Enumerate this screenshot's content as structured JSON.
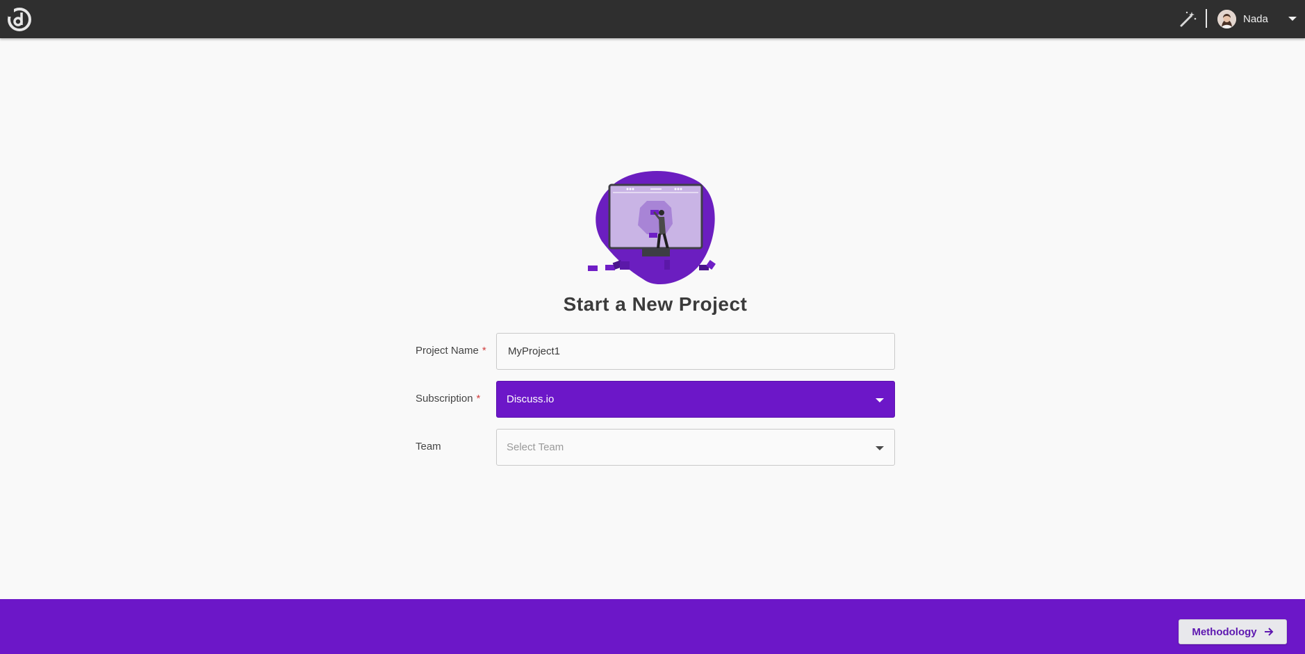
{
  "header": {
    "logo": "discuss-logo",
    "user_name": "Nada",
    "icons": [
      "magic-wand-icon",
      "avatar",
      "caret-down-icon"
    ]
  },
  "main": {
    "title": "Start a New Project",
    "form": {
      "project_name_label": "Project Name",
      "project_name_value": "MyProject1",
      "subscription_label": "Subscription",
      "subscription_value": "Discuss.io",
      "team_label": "Team",
      "team_placeholder": "Select Team",
      "required_marker": "*"
    }
  },
  "footer": {
    "methodology_label": "Methodology",
    "arrow_icon": "arrow-right-icon"
  },
  "colors": {
    "topbar": "#2f2f2f",
    "accent": "#6c17c8",
    "background": "#f9f9f9"
  }
}
